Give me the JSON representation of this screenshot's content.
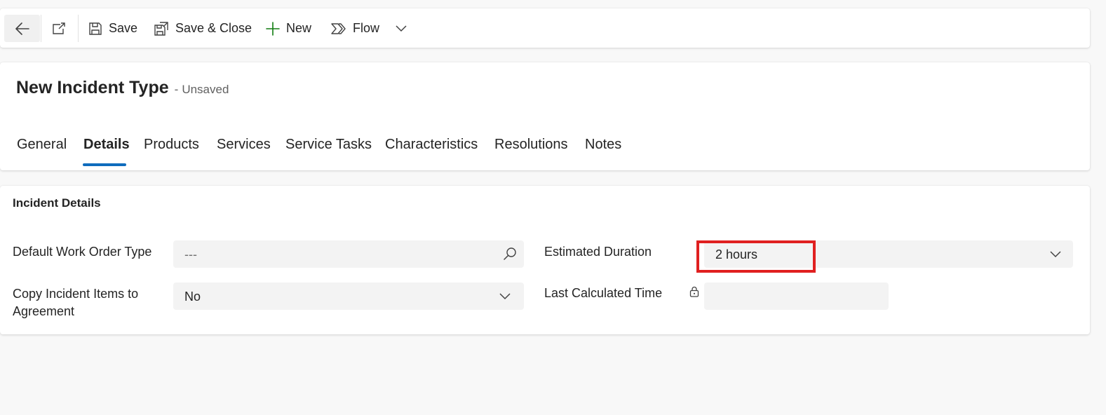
{
  "toolbar": {
    "back_icon": "arrow-left-icon",
    "popout_icon": "popout-icon",
    "save_label": "Save",
    "save_close_label": "Save & Close",
    "new_label": "New",
    "flow_label": "Flow"
  },
  "header": {
    "title": "New Incident Type",
    "separator": "-",
    "status": "Unsaved"
  },
  "tabs": [
    {
      "label": "General"
    },
    {
      "label": "Details",
      "active": true
    },
    {
      "label": "Products"
    },
    {
      "label": "Services"
    },
    {
      "label": "Service Tasks"
    },
    {
      "label": "Characteristics"
    },
    {
      "label": "Resolutions"
    },
    {
      "label": "Notes"
    }
  ],
  "section": {
    "title": "Incident Details",
    "fields": {
      "default_work_order_type": {
        "label": "Default Work Order Type",
        "value": "---"
      },
      "copy_incident_items": {
        "label": "Copy Incident Items to Agreement",
        "value": "No"
      },
      "estimated_duration": {
        "label": "Estimated Duration",
        "value": "2 hours"
      },
      "last_calculated_time": {
        "label": "Last Calculated Time",
        "value": ""
      }
    }
  },
  "colors": {
    "accent": "#0f6cbd",
    "new_icon": "#107c10",
    "highlight": "#e02020",
    "field_bg": "#f3f3f3"
  }
}
